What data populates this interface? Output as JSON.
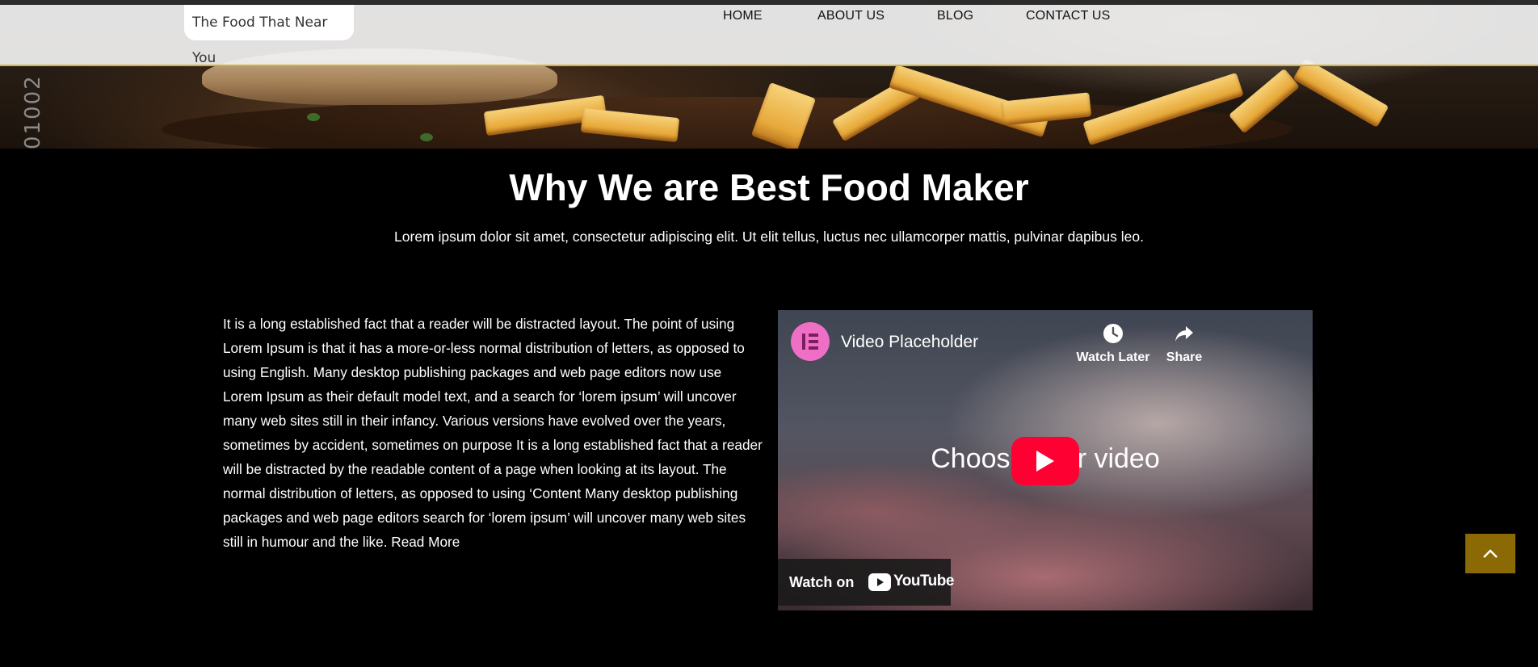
{
  "header": {
    "tagline": "The Food That Near You",
    "nav": [
      {
        "label": "HOME"
      },
      {
        "label": "ABOUT US"
      },
      {
        "label": "BLOG"
      },
      {
        "label": "CONTACT US"
      }
    ],
    "accent_color": "#d4b03a"
  },
  "hero": {
    "side_code": "01002"
  },
  "section": {
    "title": "Why We are Best Food Maker",
    "subtitle": "Lorem ipsum dolor sit amet, consectetur adipiscing elit. Ut elit tellus, luctus nec ullamcorper mattis, pulvinar dapibus leo.",
    "body": "It is a long established fact that a reader will be distracted layout. The point of using Lorem Ipsum is that it has a more-or-less normal distribution of letters, as opposed to using English. Many desktop publishing packages and web page editors now use Lorem Ipsum as their default model text, and a search for ‘lorem ipsum’ will uncover many web sites still in their infancy. Various versions have evolved over the years, sometimes by accident, sometimes on purpose It is a long established fact that a reader will be distracted by the readable content of a page when looking at its layout. The normal distribution of letters, as opposed to using ‘Content Many desktop publishing packages and web page editors search for ‘lorem ipsum’ will uncover many web sites still in humour and the like.",
    "read_more": "Read More"
  },
  "video": {
    "title": "Video Placeholder",
    "watch_later": "Watch Later",
    "share": "Share",
    "center_text": "Choose your video",
    "watch_on": "Watch on",
    "youtube": "YouTube",
    "play_color": "#ff0033",
    "avatar_color": "#ef6fc7"
  },
  "back_to_top": {
    "icon": "chevron-up-icon",
    "color": "#8b6a06"
  }
}
